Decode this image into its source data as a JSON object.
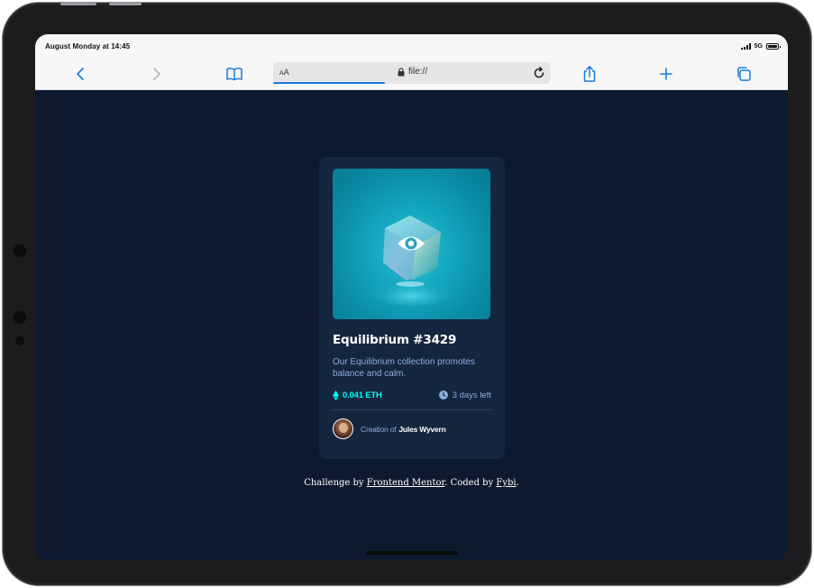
{
  "status_bar": {
    "time": "August Monday at 14:45",
    "network": "5G"
  },
  "toolbar": {
    "address_aa": "AA",
    "url": "file://"
  },
  "card": {
    "title": "Equilibrium #3429",
    "description": "Our Equilibrium collection promotes balance and calm.",
    "price": "0.041 ETH",
    "time_left": "3 days left",
    "creator_prefix": "Creation of",
    "creator_name": "Jules Wyvern"
  },
  "attribution": {
    "prefix": "Challenge by ",
    "link1": "Frontend Mentor",
    "middle": ". Coded by ",
    "link2": "Fybi",
    "suffix": "."
  },
  "colors": {
    "page_bg": "#0d1a2e",
    "card_bg": "#15263f",
    "accent_cyan": "#00fff8",
    "soft_blue": "#8bacd9",
    "safari_blue": "#1a7bd6"
  },
  "icons": [
    "back-icon",
    "forward-icon",
    "bookmarks-icon",
    "lock-icon",
    "reload-icon",
    "share-icon",
    "new-tab-icon",
    "tabs-icon",
    "eye-icon",
    "ethereum-icon",
    "clock-icon"
  ]
}
